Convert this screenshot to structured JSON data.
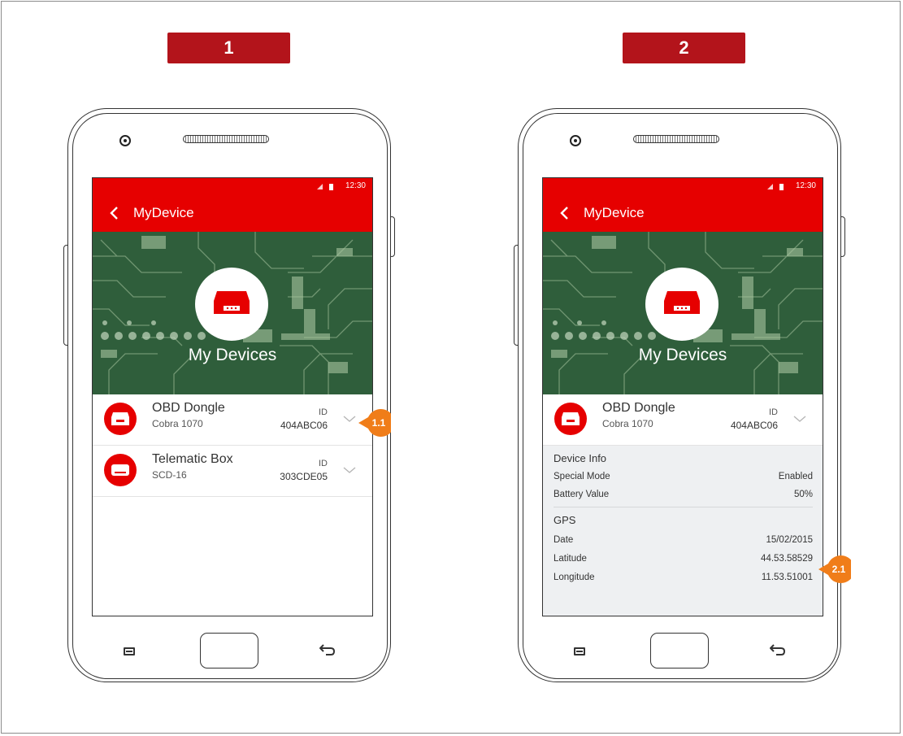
{
  "steps": [
    {
      "label": "1",
      "status_time": "12:30",
      "app_title": "MyDevice",
      "hero_title": "My Devices",
      "devices": [
        {
          "name": "OBD Dongle",
          "model": "Cobra 1070",
          "id_label": "ID",
          "id_value": "404ABC06"
        },
        {
          "name": "Telematic Box",
          "model": "SCD-16",
          "id_label": "ID",
          "id_value": "303CDE05"
        }
      ],
      "callout": "1.1"
    },
    {
      "label": "2",
      "status_time": "12:30",
      "app_title": "MyDevice",
      "hero_title": "My Devices",
      "devices": [
        {
          "name": "OBD Dongle",
          "model": "Cobra 1070",
          "id_label": "ID",
          "id_value": "404ABC06"
        }
      ],
      "details": {
        "device_info_title": "Device Info",
        "device_info": [
          {
            "label": "Special Mode",
            "value": "Enabled"
          },
          {
            "label": "Battery Value",
            "value": "50%"
          }
        ],
        "gps_title": "GPS",
        "gps": [
          {
            "label": "Date",
            "value": "15/02/2015"
          },
          {
            "label": "Latitude",
            "value": "44.53.58529"
          },
          {
            "label": "Longitude",
            "value": "11.53.51001"
          }
        ]
      },
      "callout": "2.1"
    }
  ],
  "colors": {
    "brand_red": "#e60000",
    "label_red": "#b3141b",
    "callout_orange": "#f07d19",
    "pcb_green": "#2f5e3b"
  },
  "icons": [
    "back-arrow-icon",
    "signal-icon",
    "battery-icon",
    "obd-dongle-icon",
    "telematic-box-icon",
    "chevron-down-icon",
    "camera-icon",
    "speaker-icon",
    "menu-key-icon",
    "home-key-icon",
    "back-key-icon"
  ]
}
